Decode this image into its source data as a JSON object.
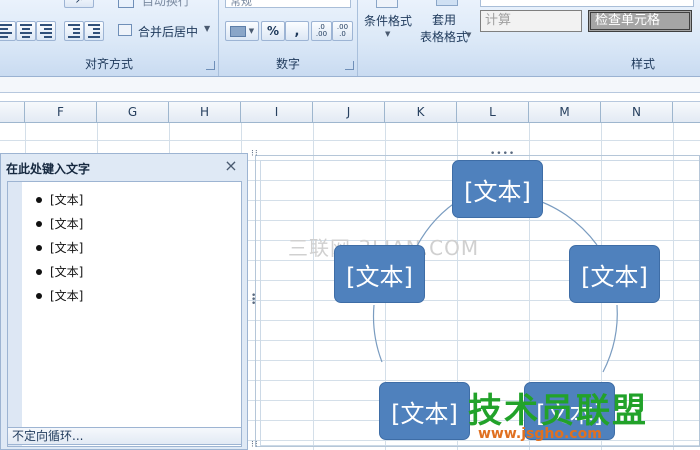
{
  "ribbon": {
    "alignment": {
      "title": "对齐方式",
      "wrap_label": "自动换行",
      "merge_label": "合并后居中"
    },
    "number": {
      "title": "数字",
      "format_value": "常规",
      "percent_label": "%",
      "comma_label": ",",
      "inc_decimal_label": ".0 .00",
      "dec_decimal_label": ".00 .0"
    },
    "styles": {
      "title": "样式",
      "conditional_format_label": "条件格式",
      "table_format_label": "套用\n表格格式",
      "calc_label": "计算",
      "check_cell_label": "检查单元格"
    }
  },
  "columns": [
    "F",
    "G",
    "H",
    "I",
    "J",
    "K",
    "L",
    "M",
    "N"
  ],
  "text_pane": {
    "title": "在此处键入文字",
    "close_glyph": "×",
    "items": [
      "[文本]",
      "[文本]",
      "[文本]",
      "[文本]",
      "[文本]"
    ],
    "footer": "不定向循环..."
  },
  "smartart": {
    "layout": "cycle",
    "nodes": [
      "[文本]",
      "[文本]",
      "[文本]",
      "[文本]",
      "[文本]"
    ],
    "fill_color": "#4f81bd",
    "border_color": "#3e6da6"
  },
  "watermarks": {
    "center": "三联网 3LIAN.COM",
    "logo": "技术员联盟",
    "logo_url": "www.jsgho.com"
  },
  "colors": {
    "ribbon_bg": "#dbe8f7",
    "accent": "#4f81bd",
    "grid": "#d4dfe9"
  }
}
